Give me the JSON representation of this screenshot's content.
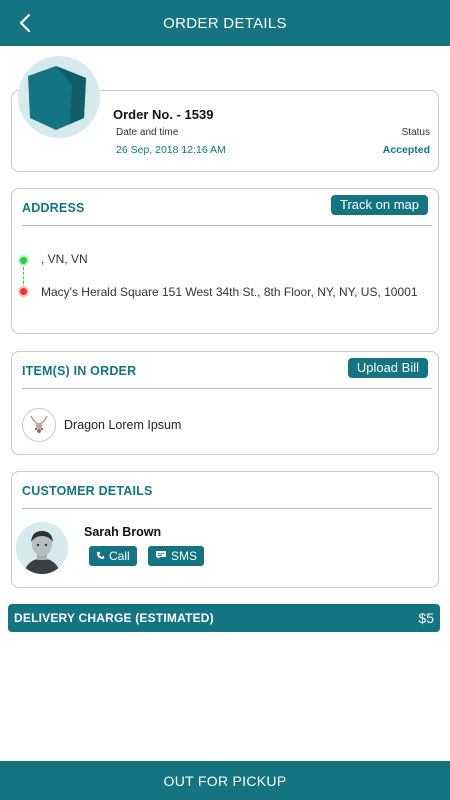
{
  "header": {
    "title": "ORDER DETAILS",
    "back_icon": "chevron-left-icon"
  },
  "order": {
    "number_label": "Order No. - 1539",
    "date_label": "Date and time",
    "date_value": "26 Sep, 2018  12:16 AM",
    "status_label": "Status",
    "status_value": "Accepted",
    "image_icon": "package-box-icon"
  },
  "address": {
    "title": "ADDRESS",
    "track_button": "Track on map",
    "pickup": ", VN, VN",
    "dropoff": "Macy's Herald Square 151 West 34th St., 8th Floor, NY, NY, US, 10001"
  },
  "items": {
    "title": "ITEM(S) IN ORDER",
    "upload_button": "Upload Bill",
    "list": [
      {
        "name": "Dragon Lorem Ipsum",
        "icon": "necklace-icon"
      }
    ]
  },
  "customer": {
    "title": "CUSTOMER DETAILS",
    "name": "Sarah Brown",
    "call_button": "Call",
    "sms_button": "SMS"
  },
  "delivery": {
    "label": "DELIVERY CHARGE (ESTIMATED)",
    "value": "$5"
  },
  "footer": {
    "action_button": "OUT FOR PICKUP"
  },
  "colors": {
    "primary": "#147482",
    "accent_bg": "#d6e9ec",
    "pickup_dot": "#2ecc40",
    "dropoff_dot": "#e53935"
  }
}
